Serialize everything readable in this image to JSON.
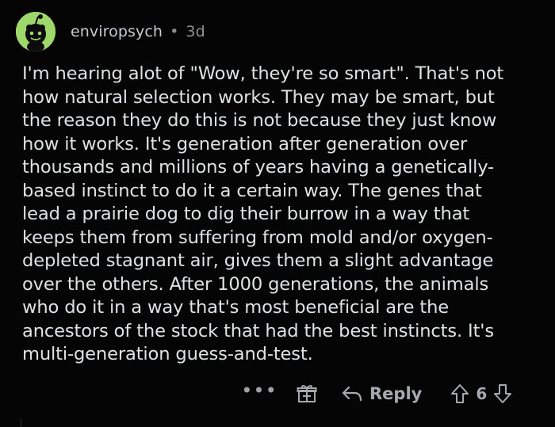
{
  "comment": {
    "username": "enviropsych",
    "separator": "•",
    "age": "3d",
    "avatar_icon": "reddit-snoo-icon",
    "avatar_color": "#9fd86a",
    "body": "I'm hearing alot of \"Wow, they're so smart\". That's not\nhow natural selection works. They may be smart, but\nthe reason they do this is not because they just know\nhow it works. It's generation after generation over\nthousands and millions of years having a genetically-\nbased instinct to do it a certain way. The genes that\nlead a prairie dog to dig their burrow in a way that\nkeeps them from suffering from mold and/or oxygen-\ndepleted stagnant air, gives them a slight advantage\nover the others. After 1000 generations, the animals\nwho do it in a way that's most beneficial are the\nancestors of the stock that had the best instincts. It's\nmulti-generation guess-and-test.",
    "actions": {
      "more": "•••",
      "award_icon": "gift-icon",
      "reply_label": "Reply",
      "reply_icon": "reply-arrow-icon",
      "upvote_icon": "upvote-icon",
      "vote_count": "6",
      "downvote_icon": "downvote-icon"
    }
  }
}
